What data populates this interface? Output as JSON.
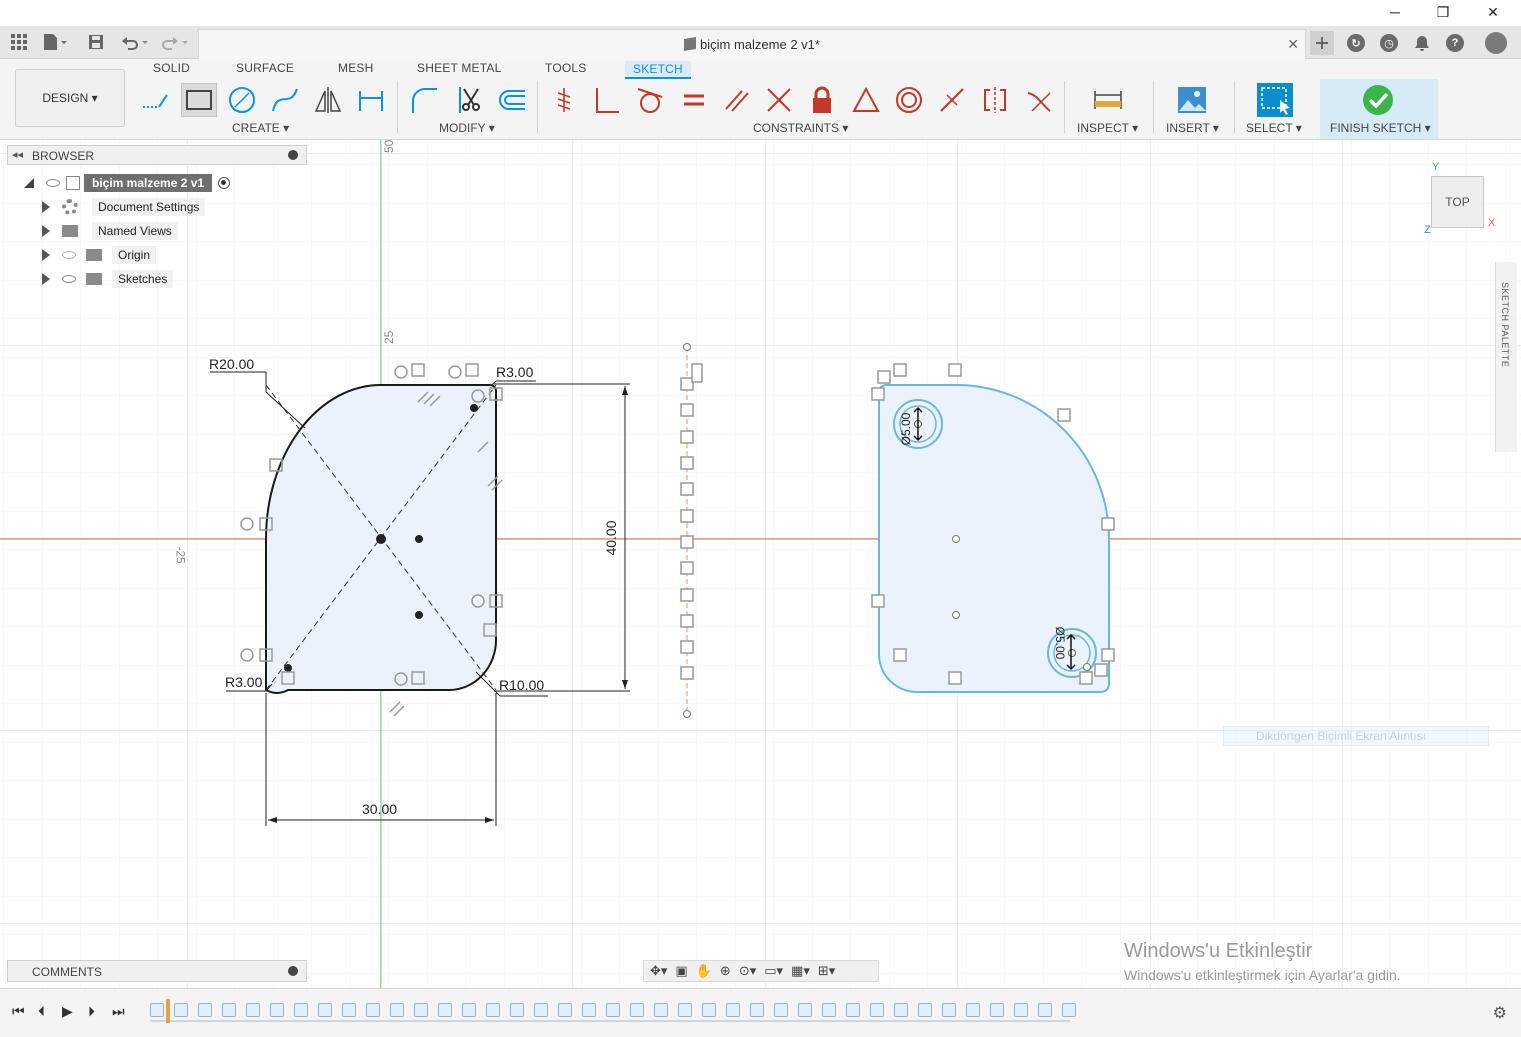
{
  "app": {
    "document_title": "biçim malzeme 2 v1*"
  },
  "ribbon": {
    "workspace": "DESIGN ▾",
    "tabs": [
      "SOLID",
      "SURFACE",
      "MESH",
      "SHEET METAL",
      "TOOLS",
      "SKETCH"
    ],
    "active_tab": "SKETCH",
    "groups": {
      "create": "CREATE ▾",
      "modify": "MODIFY ▾",
      "constraints": "CONSTRAINTS ▾",
      "inspect": "INSPECT ▾",
      "insert": "INSERT ▾",
      "select": "SELECT ▾",
      "finish": "FINISH SKETCH ▾"
    }
  },
  "browser": {
    "title": "BROWSER",
    "root": "biçim malzeme 2 v1",
    "items": [
      "Document Settings",
      "Named Views",
      "Origin",
      "Sketches"
    ]
  },
  "comments": {
    "title": "COMMENTS"
  },
  "viewcube": {
    "face": "TOP",
    "axis_y": "Y",
    "axis_x": "X",
    "axis_z": "Z"
  },
  "sketch_palette": {
    "label": "SKETCH PALETTE"
  },
  "sketch": {
    "dims": {
      "r20": "R20.00",
      "r3_top": "R3.00",
      "r3_bottom": "R3.00",
      "r10": "R10.00",
      "height": "40.00",
      "width": "30.00",
      "d_top": "Ø5.00",
      "d_bottom": "Ø5.00"
    },
    "axis_labels": {
      "top_50": "50",
      "mid_25": "25",
      "left_neg25": "-25"
    }
  },
  "ghost_tooltip": "Dikdörtgen Biçimli Ekran Alıntısı",
  "watermark": {
    "title": "Windows'u Etkinleştir",
    "subtitle": "Windows'u etkinleştirmek için Ayarlar'a gidin."
  },
  "colors": {
    "accent": "#0696d7",
    "sketch_fill": "#eaf3fb",
    "profile_blue": "#6bb6dd",
    "axis_red": "#e26a5c",
    "axis_green": "#73d883",
    "finish_green": "#3bb54a"
  }
}
